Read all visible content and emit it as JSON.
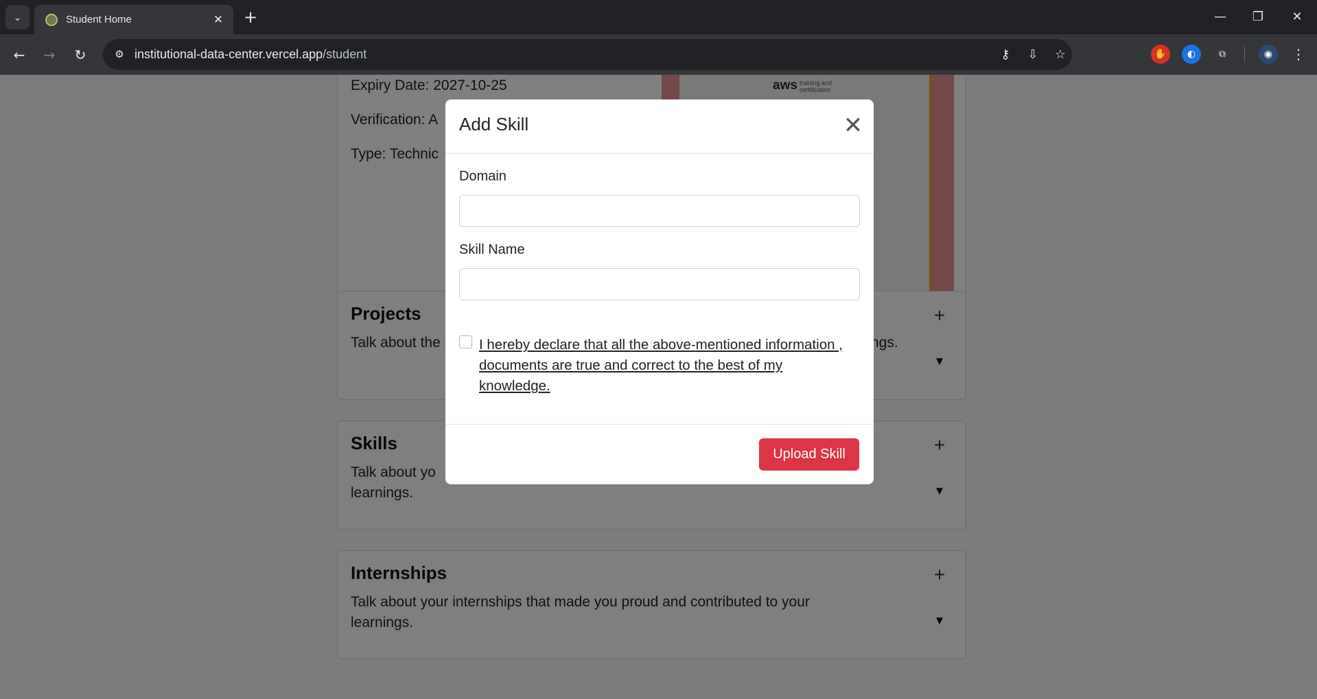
{
  "browser": {
    "tab_title": "Student Home",
    "url_host": "institutional-data-center.vercel.app",
    "url_path": "/student"
  },
  "certificate": {
    "expiry": "Expiry Date: 2027-10-25",
    "verification": "Verification: A",
    "type": "Type: Technic",
    "logo_text": "aws",
    "logo_sub": "training and certification"
  },
  "sections": {
    "projects": {
      "title": "Projects",
      "desc_left": "Talk about the",
      "desc_right": "ngs."
    },
    "skills": {
      "title": "Skills",
      "desc": "Talk about yo",
      "desc2": "learnings."
    },
    "internships": {
      "title": "Internships",
      "desc": "Talk about your internships that made you proud and contributed to your learnings."
    }
  },
  "modal": {
    "title": "Add Skill",
    "close_glyph": "✕",
    "domain_label": "Domain",
    "domain_value": "",
    "skill_label": "Skill Name",
    "skill_value": "",
    "declaration": "I hereby declare that all the above-mentioned information , documents are true and correct to the best of my knowledge.",
    "declaration_checked": false,
    "submit_label": "Upload Skill",
    "submit_color": "#dc3545"
  }
}
